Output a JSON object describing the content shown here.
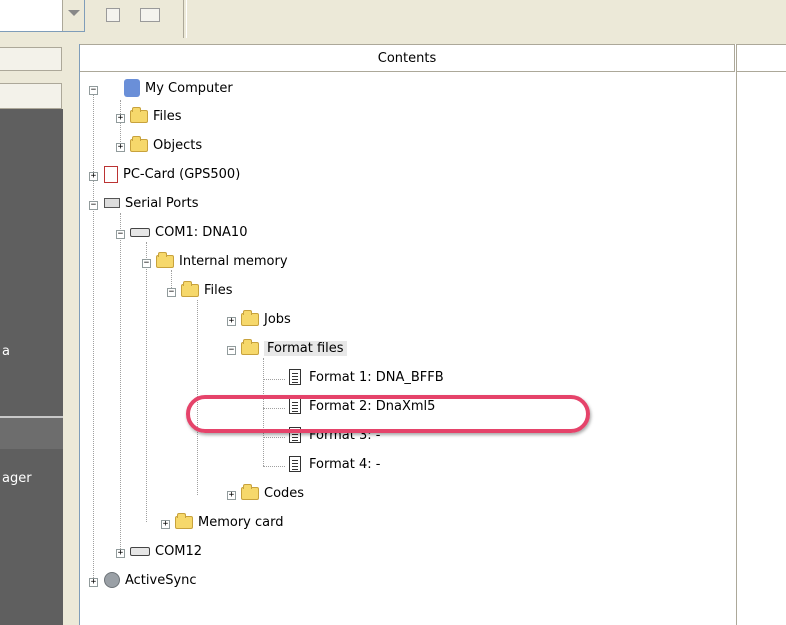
{
  "left_panel": {
    "item_a": "a",
    "item_manager": "ager"
  },
  "contents": {
    "header": "Contents"
  },
  "tree": {
    "my_computer": "My Computer",
    "files": "Files",
    "objects": "Objects",
    "pc_card": "PC-Card (GPS500)",
    "serial_ports": "Serial Ports",
    "com1": "COM1: DNA10",
    "internal_memory": "Internal memory",
    "files_sub": "Files",
    "jobs": "Jobs",
    "format_files": "Format files",
    "format1": "Format 1: DNA_BFFB",
    "format2": "Format 2: DnaXml5",
    "format3": "Format 3: -",
    "format4": "Format 4: -",
    "codes": "Codes",
    "memory_card": "Memory card",
    "com12": "COM12",
    "activesync": "ActiveSync"
  },
  "colors": {
    "highlight_ring": "#e5436a",
    "dark_panel": "#5f5f5f"
  }
}
